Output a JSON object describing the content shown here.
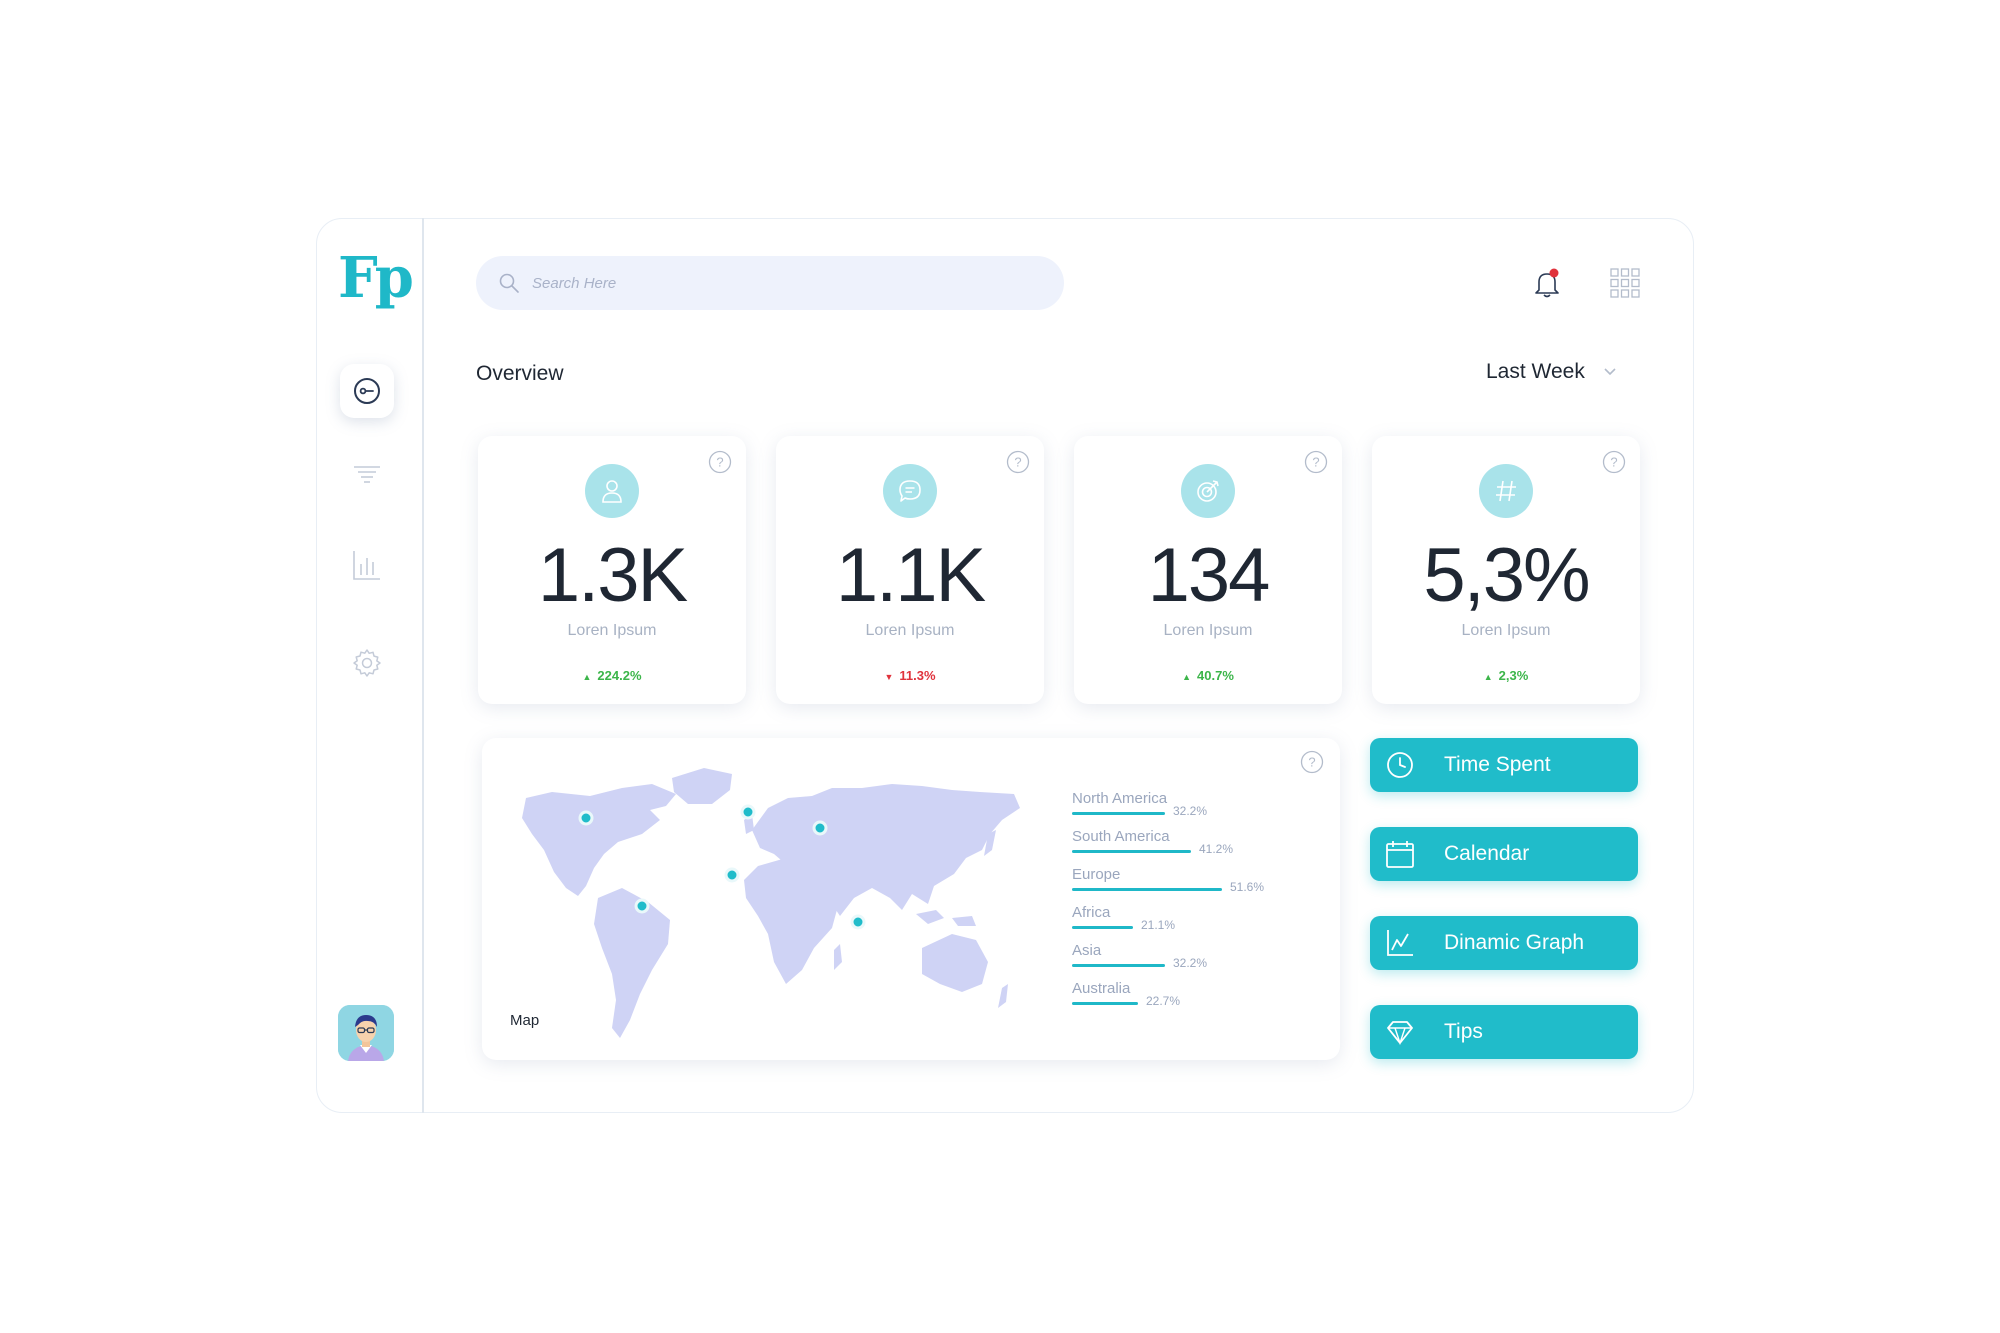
{
  "brand": {
    "logo_text": "Fp"
  },
  "search": {
    "placeholder": "Search Here"
  },
  "header": {
    "title": "Overview",
    "period": "Last Week"
  },
  "sidebar": {
    "items": [
      {
        "name": "dashboard",
        "icon": "dashboard-icon",
        "active": true
      },
      {
        "name": "filter",
        "icon": "filter-icon",
        "active": false
      },
      {
        "name": "analytics",
        "icon": "bar-chart-icon",
        "active": false
      },
      {
        "name": "settings",
        "icon": "gear-icon",
        "active": false
      }
    ]
  },
  "stats": [
    {
      "icon": "user-icon",
      "value": "1.3K",
      "label": "Loren Ipsum",
      "change": "224.2%",
      "direction": "up"
    },
    {
      "icon": "chat-icon",
      "value": "1.1K",
      "label": "Loren Ipsum",
      "change": "11.3%",
      "direction": "down"
    },
    {
      "icon": "target-icon",
      "value": "134",
      "label": "Loren Ipsum",
      "change": "40.7%",
      "direction": "up"
    },
    {
      "icon": "hashtag-icon",
      "value": "5,3%",
      "label": "Loren Ipsum",
      "change": "2,3%",
      "direction": "up"
    }
  ],
  "map": {
    "label": "Map",
    "regions": [
      {
        "name": "North America",
        "value": "32.2%",
        "pct": 32.2
      },
      {
        "name": "South America",
        "value": "41.2%",
        "pct": 41.2
      },
      {
        "name": "Europe",
        "value": "51.6%",
        "pct": 51.6
      },
      {
        "name": "Africa",
        "value": "21.1%",
        "pct": 21.1
      },
      {
        "name": "Asia",
        "value": "32.2%",
        "pct": 32.2
      },
      {
        "name": "Australia",
        "value": "22.7%",
        "pct": 22.7
      }
    ]
  },
  "actions": [
    {
      "label": "Time Spent",
      "icon": "clock-icon"
    },
    {
      "label": "Calendar",
      "icon": "calendar-icon"
    },
    {
      "label": "Dinamic Graph",
      "icon": "line-graph-icon"
    },
    {
      "label": "Tips",
      "icon": "diamond-icon"
    }
  ],
  "colors": {
    "accent": "#20bcca",
    "up": "#3cb54a",
    "down": "#e0323c",
    "map_land": "#cfd3f5"
  }
}
